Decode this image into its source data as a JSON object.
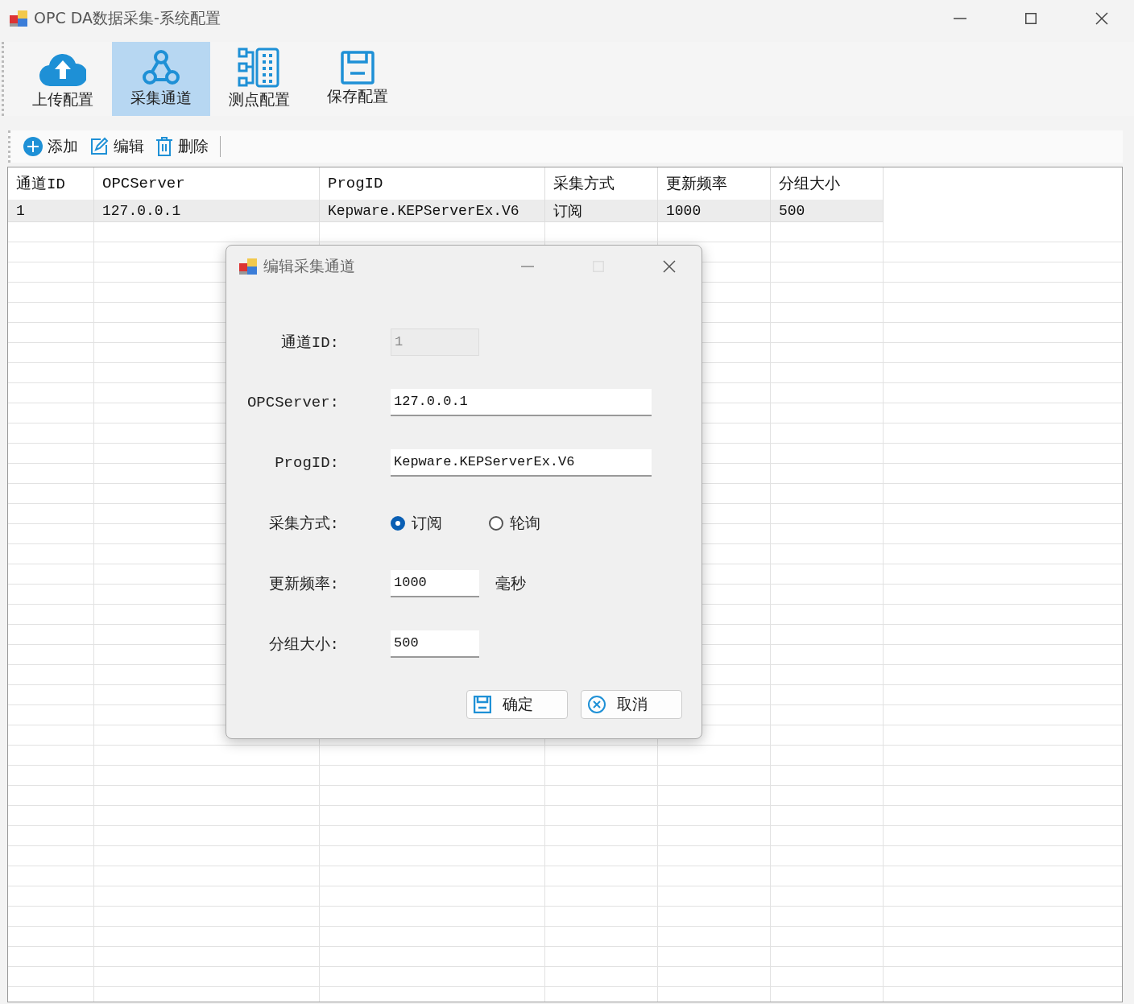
{
  "window": {
    "title": "OPC DA数据采集-系统配置"
  },
  "ribbon": [
    {
      "label": "上传配置",
      "kind": "upload",
      "selected": false
    },
    {
      "label": "采集通道",
      "kind": "network",
      "selected": true
    },
    {
      "label": "测点配置",
      "kind": "points",
      "selected": false
    },
    {
      "label": "保存配置",
      "kind": "save",
      "selected": false
    }
  ],
  "toolbar": [
    {
      "label": "添加",
      "kind": "add"
    },
    {
      "label": "编辑",
      "kind": "edit"
    },
    {
      "label": "删除",
      "kind": "delete"
    }
  ],
  "table": {
    "columns": [
      "通道ID",
      "OPCServer",
      "ProgID",
      "采集方式",
      "更新频率",
      "分组大小"
    ],
    "rows": [
      {
        "cells": [
          "1",
          "127.0.0.1",
          "Kepware.KEPServerEx.V6",
          "订阅",
          "1000",
          "500"
        ],
        "selected": true
      }
    ]
  },
  "dialog": {
    "title": "编辑采集通道",
    "fields": [
      {
        "label": "通道ID:",
        "kind": "text",
        "value": "1",
        "disabled": true
      },
      {
        "label": "OPCServer:",
        "kind": "wide-text",
        "value": "127.0.0.1",
        "disabled": false
      },
      {
        "label": "ProgID:",
        "kind": "wide-text",
        "value": "Kepware.KEPServerEx.V6",
        "disabled": false
      },
      {
        "label": "采集方式:",
        "kind": "radio",
        "options": [
          {
            "label": "订阅",
            "selected": true
          },
          {
            "label": "轮询",
            "selected": false
          }
        ]
      },
      {
        "label": "更新频率:",
        "kind": "text",
        "value": "1000",
        "disabled": false,
        "unit": "毫秒"
      },
      {
        "label": "分组大小:",
        "kind": "text",
        "value": "500",
        "disabled": false
      }
    ],
    "buttons": [
      {
        "label": "确定",
        "kind": "save"
      },
      {
        "label": "取消",
        "kind": "cancel"
      }
    ]
  }
}
